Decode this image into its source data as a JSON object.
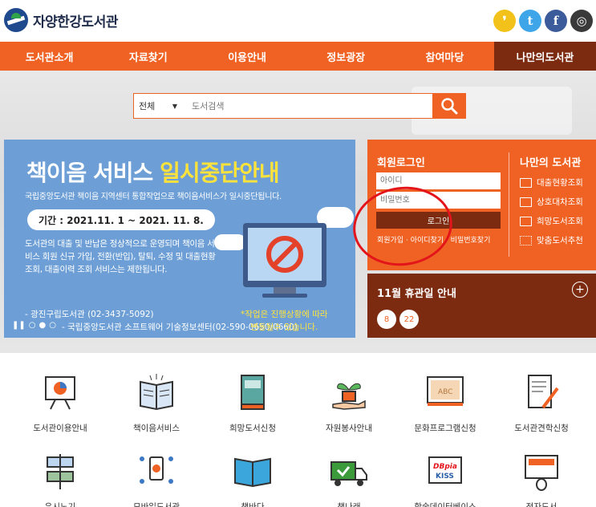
{
  "header": {
    "logo_text": "자양한강도서관",
    "sns": [
      {
        "name": "kakaostory",
        "glyph": "❜",
        "color": "#f2c21a"
      },
      {
        "name": "twitter",
        "glyph": "t",
        "color": "#3da5e8"
      },
      {
        "name": "facebook",
        "glyph": "f",
        "color": "#3c5b9a"
      },
      {
        "name": "instagram",
        "glyph": "◎",
        "color": "#3a3a3a"
      }
    ]
  },
  "gnb": [
    "도서관소개",
    "자료찾기",
    "이용안내",
    "정보광장",
    "참여마당",
    "나만의도서관"
  ],
  "search": {
    "select_value": "전체",
    "placeholder": "도서검색"
  },
  "banner": {
    "title_part1": "책이음 서비스 ",
    "title_part2": "일시중단안내",
    "subtitle": "국립중앙도서관 책이음 지역센터 통합작업으로 책이음서비스가 일시중단됩니다.",
    "period": "기간 : 2021.11. 1 ~ 2021. 11. 8.",
    "body": "도서관의 대출 및 반납은 정상적으로 운영되며 책이음 서비스 회원 신규 가입, 전환(반입), 탈퇴, 수정 및 대출현황 조회, 대출이력 조회 서비스는 제한됩니다.",
    "contact1": "- 광진구립도서관 (02-3437-5092)",
    "contact2": "- 국립중앙도서관 소프트웨어 기술정보센터(02-590-0650/0660)",
    "note1": "*작업은 진행상황에 따라",
    "note2": "변동될수 있습니다.",
    "controls": [
      "❚❚",
      "○",
      "●",
      "○"
    ]
  },
  "login": {
    "title": "회원로그인",
    "id_placeholder": "아이디",
    "pw_placeholder": "비밀번호",
    "button": "로그인",
    "links": "회원가입 · 아이디찾기 · 비밀번호찾기"
  },
  "mylib": {
    "title": "나만의 도서관",
    "items": [
      "대출현황조회",
      "상호대차조회",
      "희망도서조회",
      "맞춤도서추천"
    ]
  },
  "closed": {
    "title": "11월 휴관일 안내",
    "days": [
      "8",
      "22"
    ]
  },
  "quick": {
    "row1": [
      "도서관이용안내",
      "책이음서비스",
      "희망도서신청",
      "자원봉사안내",
      "문화프로그램신청",
      "도서관견학신청"
    ],
    "row2": [
      "유시노기",
      "모바일도서관",
      "책바다",
      "책나래",
      "학술데이터베이스",
      "전자도서"
    ],
    "abc_text": "ABC",
    "dbpia_text": "DBpia",
    "kiss_text": "KISS"
  },
  "colors": {
    "accent": "#ef6223",
    "dark": "#7c2a10",
    "banner": "#6d9fd6",
    "highlight": "#ffe33b"
  }
}
